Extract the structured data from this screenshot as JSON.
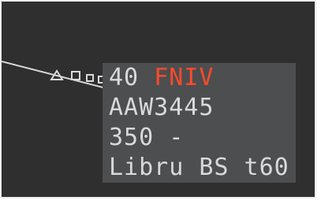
{
  "track_label": {
    "altitude": "40",
    "alert": "FNIV",
    "callsign": "AAW3445",
    "level_line": "350 -",
    "info_line": "Libru BS t60"
  },
  "colors": {
    "background": "#2f2f2f",
    "label_bg": "#4c4e4f",
    "text": "#d9d9d9",
    "alert": "#ff4a2c"
  },
  "icons": [
    "aircraft-position-triangle-icon",
    "history-dot-icon",
    "history-dot-icon",
    "history-dot-icon"
  ]
}
